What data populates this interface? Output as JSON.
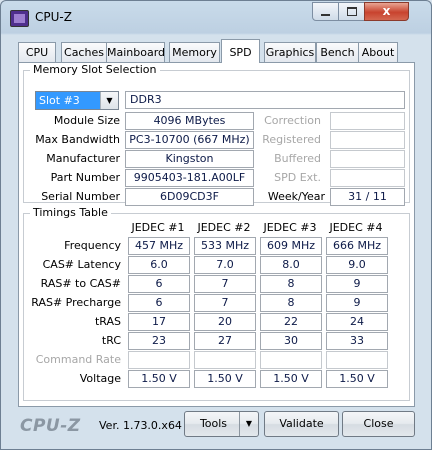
{
  "window": {
    "title": "CPU-Z"
  },
  "titlebar": {
    "minimize": "",
    "maximize": "",
    "close": "x"
  },
  "tabs": [
    "CPU",
    "Caches",
    "Mainboard",
    "Memory",
    "SPD",
    "Graphics",
    "Bench",
    "About"
  ],
  "active_tab": "SPD",
  "slot": {
    "legend": "Memory Slot Selection",
    "selected": "Slot #3",
    "type": "DDR3",
    "labels": {
      "module_size": "Module Size",
      "max_bandwidth": "Max Bandwidth",
      "manufacturer": "Manufacturer",
      "part_number": "Part Number",
      "serial_number": "Serial Number",
      "correction": "Correction",
      "registered": "Registered",
      "buffered": "Buffered",
      "spd_ext": "SPD Ext.",
      "week_year": "Week/Year"
    },
    "values": {
      "module_size": "4096 MBytes",
      "max_bandwidth": "PC3-10700 (667 MHz)",
      "manufacturer": "Kingston",
      "part_number": "9905403-181.A00LF",
      "serial_number": "6D09CD3F",
      "week_year": "31 / 11"
    }
  },
  "timings": {
    "legend": "Timings Table",
    "columns": [
      "JEDEC #1",
      "JEDEC #2",
      "JEDEC #3",
      "JEDEC #4"
    ],
    "rows": [
      {
        "label": "Frequency",
        "values": [
          "457 MHz",
          "533 MHz",
          "609 MHz",
          "666 MHz"
        ]
      },
      {
        "label": "CAS# Latency",
        "values": [
          "6.0",
          "7.0",
          "8.0",
          "9.0"
        ]
      },
      {
        "label": "RAS# to CAS#",
        "values": [
          "6",
          "7",
          "8",
          "9"
        ]
      },
      {
        "label": "RAS# Precharge",
        "values": [
          "6",
          "7",
          "8",
          "9"
        ]
      },
      {
        "label": "tRAS",
        "values": [
          "17",
          "20",
          "22",
          "24"
        ]
      },
      {
        "label": "tRC",
        "values": [
          "23",
          "27",
          "30",
          "33"
        ]
      },
      {
        "label": "Command Rate",
        "values": [
          "",
          "",
          "",
          ""
        ]
      },
      {
        "label": "Voltage",
        "values": [
          "1.50 V",
          "1.50 V",
          "1.50 V",
          "1.50 V"
        ]
      }
    ]
  },
  "footer": {
    "logo": "CPU-Z",
    "version": "Ver. 1.73.0.x64",
    "tools": "Tools",
    "validate": "Validate",
    "close": "Close"
  },
  "colors": {
    "value_text": "#0d1a48",
    "selection": "#3399ff",
    "disabled": "#a7a7a7"
  }
}
